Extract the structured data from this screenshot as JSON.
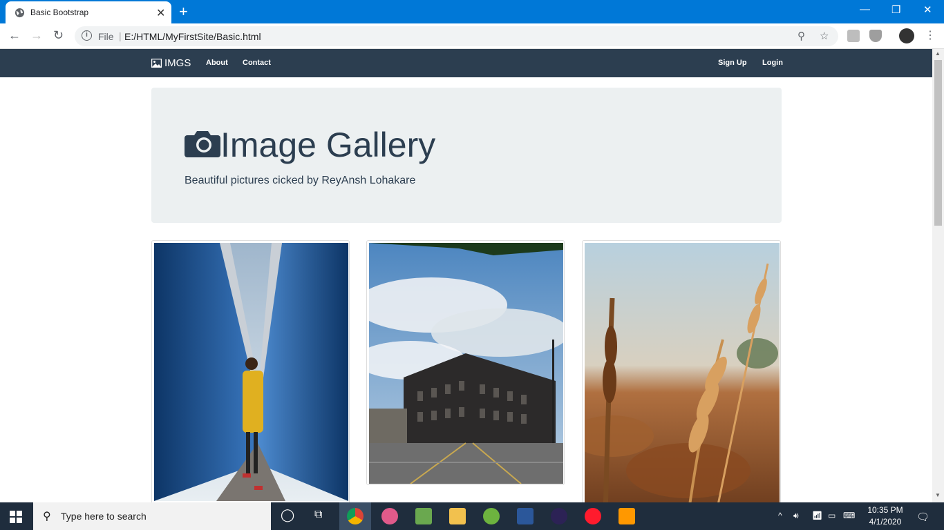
{
  "browser": {
    "tab_title": "Basic Bootstrap",
    "file_label": "File",
    "url": "E:/HTML/MyFirstSite/Basic.html"
  },
  "site": {
    "brand": "IMGS",
    "nav_left": [
      "About",
      "Contact"
    ],
    "nav_right": [
      "Sign Up",
      "Login"
    ],
    "jumbotron": {
      "title": "Image Gallery",
      "subtitle": "Beautiful pictures cicked by ReyAnsh Lohakare"
    },
    "colors": {
      "navbar": "#2c3e50",
      "jumbotron_bg": "#ecf0f1",
      "text": "#2c3e50"
    }
  },
  "taskbar": {
    "search_placeholder": "Type here to search",
    "time": "10:35 PM",
    "date": "4/1/2020"
  }
}
